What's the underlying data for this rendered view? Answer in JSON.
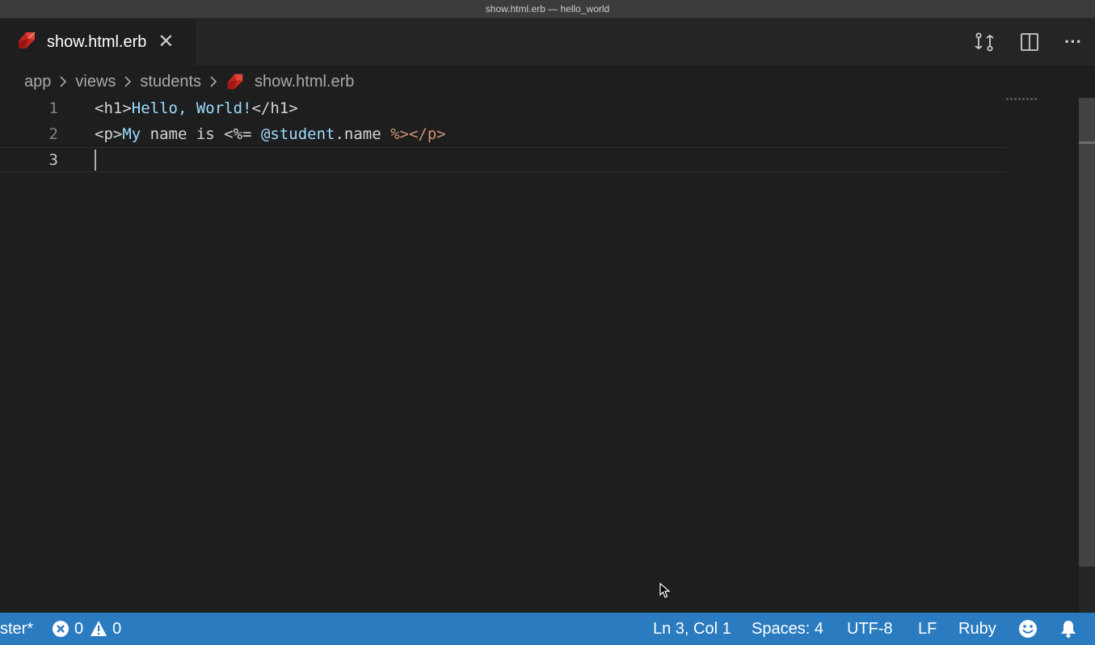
{
  "window": {
    "title": "show.html.erb — hello_world"
  },
  "tab": {
    "label": "show.html.erb",
    "close_glyph": "✕",
    "icon": "ruby-icon"
  },
  "toolbar": {
    "icons": [
      "open-changes-icon",
      "split-editor-icon",
      "more-actions-icon"
    ],
    "more_glyph": "···"
  },
  "breadcrumb": {
    "items": [
      "app",
      "views",
      "students"
    ],
    "file": "show.html.erb"
  },
  "editor": {
    "line_numbers": [
      "1",
      "2",
      "3"
    ],
    "lines": [
      {
        "tokens": [
          {
            "text": "<h1>",
            "kind": "tag"
          },
          {
            "text": "Hello, World!",
            "kind": "text"
          },
          {
            "text": "</h1>",
            "kind": "tag"
          }
        ]
      },
      {
        "tokens": [
          {
            "text": "<p>",
            "kind": "tag"
          },
          {
            "text": "My",
            "kind": "text"
          },
          {
            "text": " name is <%= ",
            "kind": "plain"
          },
          {
            "text": "@student",
            "kind": "text"
          },
          {
            "text": ".name ",
            "kind": "plain"
          },
          {
            "text": "%></p>",
            "kind": "erb"
          }
        ]
      },
      {
        "tokens": []
      }
    ]
  },
  "status": {
    "branch": "ster*",
    "errors": "0",
    "warnings": "0",
    "position": "Ln 3, Col 1",
    "spaces": "Spaces: 4",
    "encoding": "UTF-8",
    "eol": "LF",
    "language": "Ruby"
  },
  "colors": {
    "statusbar": "#2a7bc0",
    "editor_bg": "#1e1e1e",
    "tabbar_bg": "#252526",
    "ruby": "#c4261d"
  }
}
